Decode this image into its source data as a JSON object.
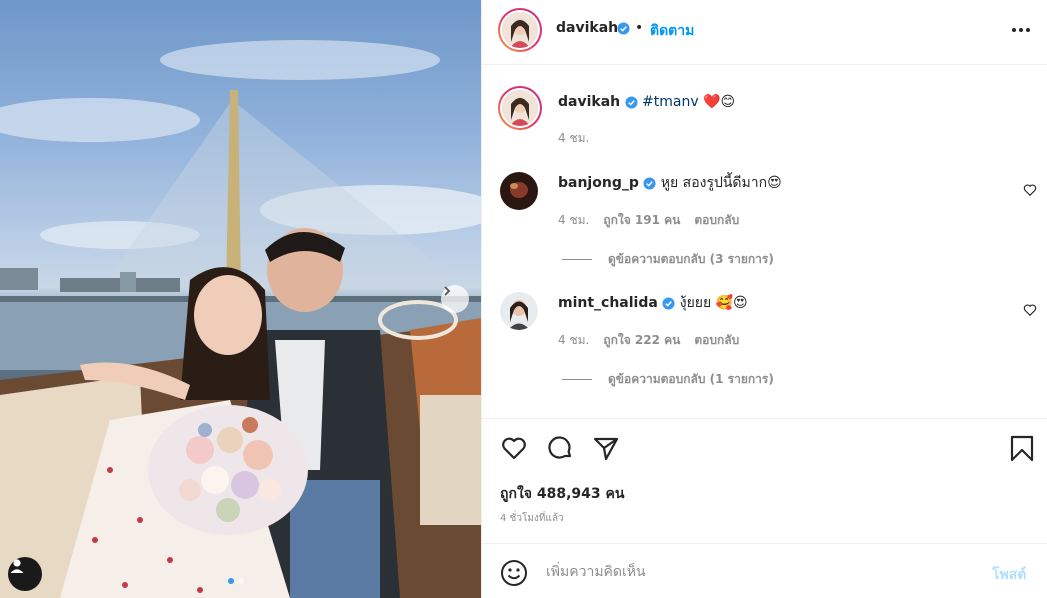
{
  "post": {
    "author": "davikah",
    "follow_label": "ติดตาม",
    "caption_hashtag": "#tmanv",
    "caption_emoji": "❤️😊",
    "caption_age": "4 ชม.",
    "likes_text": "ถูกใจ 488,943 คน",
    "posted_time": "4 ชั่วโมงที่แล้ว"
  },
  "comments": [
    {
      "username": "banjong_p",
      "text": "หูย สองรูปนี้ดีมาก😍",
      "age": "4 ชม.",
      "likes": "ถูกใจ 191 คน",
      "reply_label": "ตอบกลับ",
      "view_replies": "ดูข้อความตอบกลับ (3 รายการ)"
    },
    {
      "username": "mint_chalida",
      "text": "งุ้ยยย 🥰😍",
      "age": "4 ชม.",
      "likes": "ถูกใจ 222 คน",
      "reply_label": "ตอบกลับ",
      "view_replies": "ดูข้อความตอบกลับ (1 รายการ)"
    }
  ],
  "comment_box": {
    "placeholder": "เพิ่มความคิดเห็น",
    "post_label": "โพสต์"
  },
  "carousel": {
    "count": 2,
    "active_index": 0
  },
  "colors": {
    "verified": "#3897f0",
    "follow": "#0095f6",
    "post_disabled": "#b2dffc",
    "muted": "#8e8e8e",
    "text": "#262626"
  },
  "icons": [
    "chevron-right-icon",
    "user-tag-icon",
    "verified-badge-icon",
    "more-icon",
    "heart-icon",
    "comment-icon",
    "share-icon",
    "bookmark-icon",
    "emoji-icon"
  ]
}
